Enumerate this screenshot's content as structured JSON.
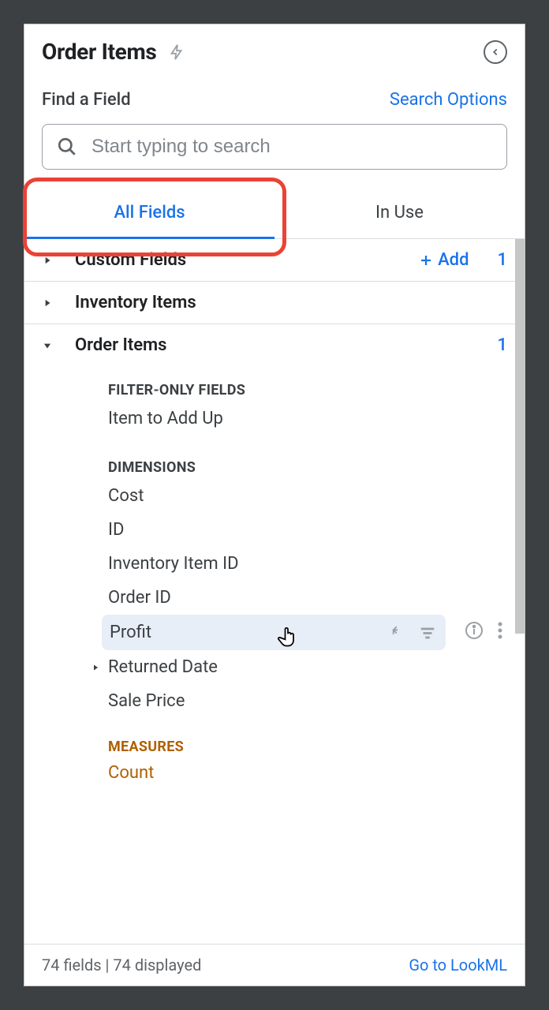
{
  "header": {
    "title": "Order Items"
  },
  "find": {
    "label": "Find a Field",
    "options_link": "Search Options",
    "placeholder": "Start typing to search"
  },
  "tabs": {
    "all_fields": "All Fields",
    "in_use": "In Use"
  },
  "sections": {
    "custom": {
      "label": "Custom Fields",
      "add": "Add",
      "count": "1"
    },
    "inventory": {
      "label": "Inventory Items"
    },
    "order": {
      "label": "Order Items",
      "count": "1"
    }
  },
  "cats": {
    "filter_only": "FILTER-ONLY FIELDS",
    "dimensions": "DIMENSIONS",
    "measures": "MEASURES"
  },
  "fields": {
    "item_to_add": "Item to Add Up",
    "cost": "Cost",
    "id": "ID",
    "inv_item_id": "Inventory Item ID",
    "order_id": "Order ID",
    "profit": "Profit",
    "returned_date": "Returned Date",
    "sale_price": "Sale Price",
    "count": "Count"
  },
  "footer": {
    "stats": "74 fields | 74 displayed",
    "goto": "Go to LookML"
  }
}
